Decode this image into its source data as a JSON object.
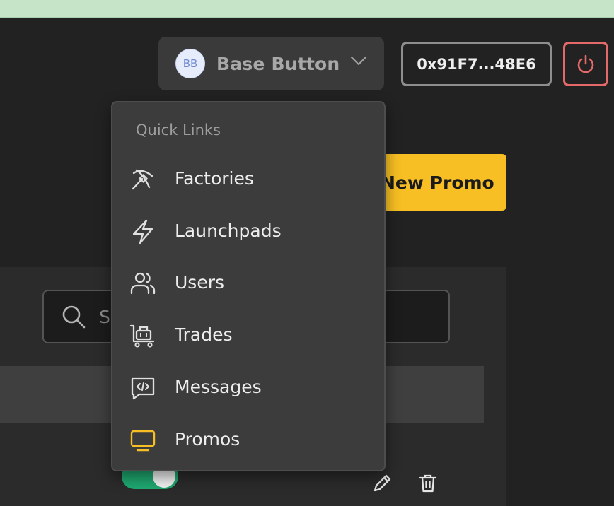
{
  "user_menu": {
    "avatar_initials": "BB",
    "name": "Base Button"
  },
  "wallet": {
    "address": "0x91F7...48E6"
  },
  "actions": {
    "new_promo_label": "New Promo"
  },
  "search": {
    "visible_text": "S"
  },
  "quick_links": {
    "title": "Quick Links",
    "items": [
      {
        "label": "Factories",
        "icon": "pickaxe-icon"
      },
      {
        "label": "Launchpads",
        "icon": "lightning-icon"
      },
      {
        "label": "Users",
        "icon": "users-icon"
      },
      {
        "label": "Trades",
        "icon": "cart-icon"
      },
      {
        "label": "Messages",
        "icon": "message-code-icon"
      },
      {
        "label": "Promos",
        "icon": "monitor-icon",
        "active": true
      }
    ]
  },
  "colors": {
    "accent_yellow": "#f7bf24",
    "toggle_green": "#1fa870",
    "danger_red": "#e46a6a"
  }
}
